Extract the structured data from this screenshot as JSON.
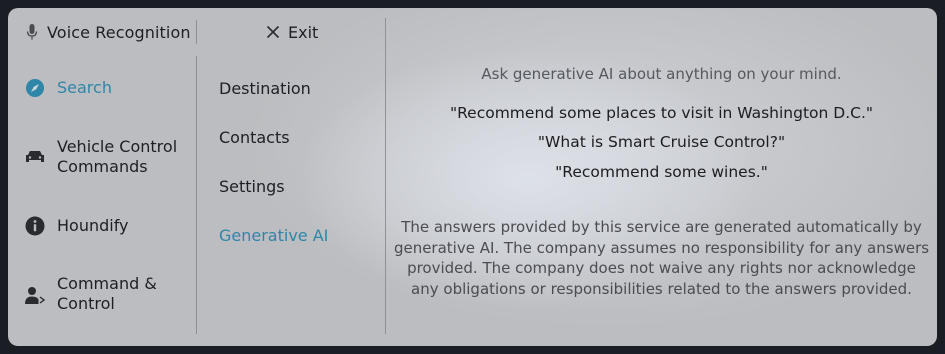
{
  "header": {
    "title": "Voice Recognition",
    "exit_label": "Exit"
  },
  "categories": [
    {
      "label": "Search",
      "icon": "compass-icon",
      "active": true
    },
    {
      "label": "Vehicle Control Commands",
      "icon": "car-icon",
      "active": false
    },
    {
      "label": "Houndify",
      "icon": "info-icon",
      "active": false
    },
    {
      "label": "Command & Control",
      "icon": "user-voice-icon",
      "active": false
    }
  ],
  "subcategories": [
    {
      "label": "Destination",
      "active": false
    },
    {
      "label": "Contacts",
      "active": false
    },
    {
      "label": "Settings",
      "active": false
    },
    {
      "label": "Generative AI",
      "active": true
    }
  ],
  "content": {
    "intro": "Ask generative AI about anything on your mind.",
    "examples": [
      "\"Recommend some places to visit in Washington D.C.\"",
      "\"What is Smart Cruise Control?\"",
      "\"Recommend some wines.\""
    ],
    "disclaimer": "The answers provided by this service are generated automatically by generative AI. The company assumes no responsibility for any answers provided. The company does not waive any rights nor acknowledge any obligations or responsibilities related to the answers provided."
  },
  "colors": {
    "accent": "#2e86a8",
    "text": "#1e1f22",
    "muted": "#55585e",
    "panel": "#bcbdc0"
  }
}
